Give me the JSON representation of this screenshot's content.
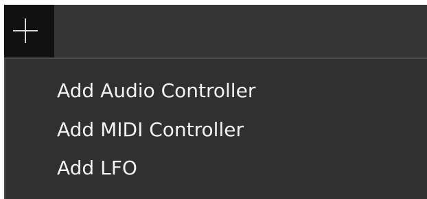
{
  "toolbar": {
    "add_button": {
      "icon": "plus-icon"
    }
  },
  "menu": {
    "items": [
      {
        "label": "Add Audio Controller"
      },
      {
        "label": "Add MIDI Controller"
      },
      {
        "label": "Add LFO"
      }
    ]
  },
  "colors": {
    "toolbar_background": "#353535",
    "add_button_background": "#111111",
    "menu_background": "#303030",
    "menu_text": "#f2f2f2",
    "icon": "#d9d9d9"
  }
}
